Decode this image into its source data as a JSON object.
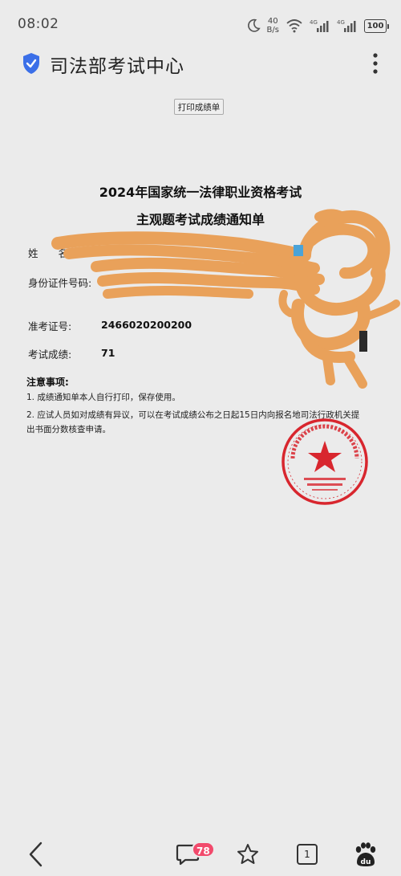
{
  "status_bar": {
    "time": "08:02",
    "net_speed_value": "40",
    "net_speed_unit": "B/s",
    "battery": "100",
    "icons": [
      "moon-icon",
      "wifi-icon",
      "signal-4g-icon",
      "signal-4g-icon",
      "battery-icon"
    ]
  },
  "header": {
    "title": "司法部考试中心",
    "icons": [
      "shield-check-icon",
      "more-vertical-icon"
    ],
    "accent_color": "#3b6fe8"
  },
  "print_button": {
    "label": "打印成绩单"
  },
  "document": {
    "title_line1": "2024年国家统一法律职业资格考试",
    "title_line2": "主观题考试成绩通知单",
    "fields": [
      {
        "label": "姓　　名:",
        "value": ""
      },
      {
        "label": "身份证件号码:",
        "value": ""
      },
      {
        "label": "准考证号:",
        "value": "2466020200200"
      },
      {
        "label": "考试成绩:",
        "value": "71"
      }
    ],
    "notes_title": "注意事项:",
    "notes": [
      "1. 成绩通知单本人自行打印，保存使用。",
      "2. 应试人员如对成绩有异议，可以在考试成绩公布之日起15日内向报名地司法行政机关提",
      "出书面分数核查申请。"
    ],
    "seal_color": "#d8262e",
    "redaction_color": "#e9a15a"
  },
  "bottom_nav": {
    "comments_badge": "78",
    "tabs_count": "1",
    "icons": [
      "back-arrow-icon",
      "comment-icon",
      "star-icon",
      "tabs-icon",
      "baidu-paw-icon"
    ]
  }
}
